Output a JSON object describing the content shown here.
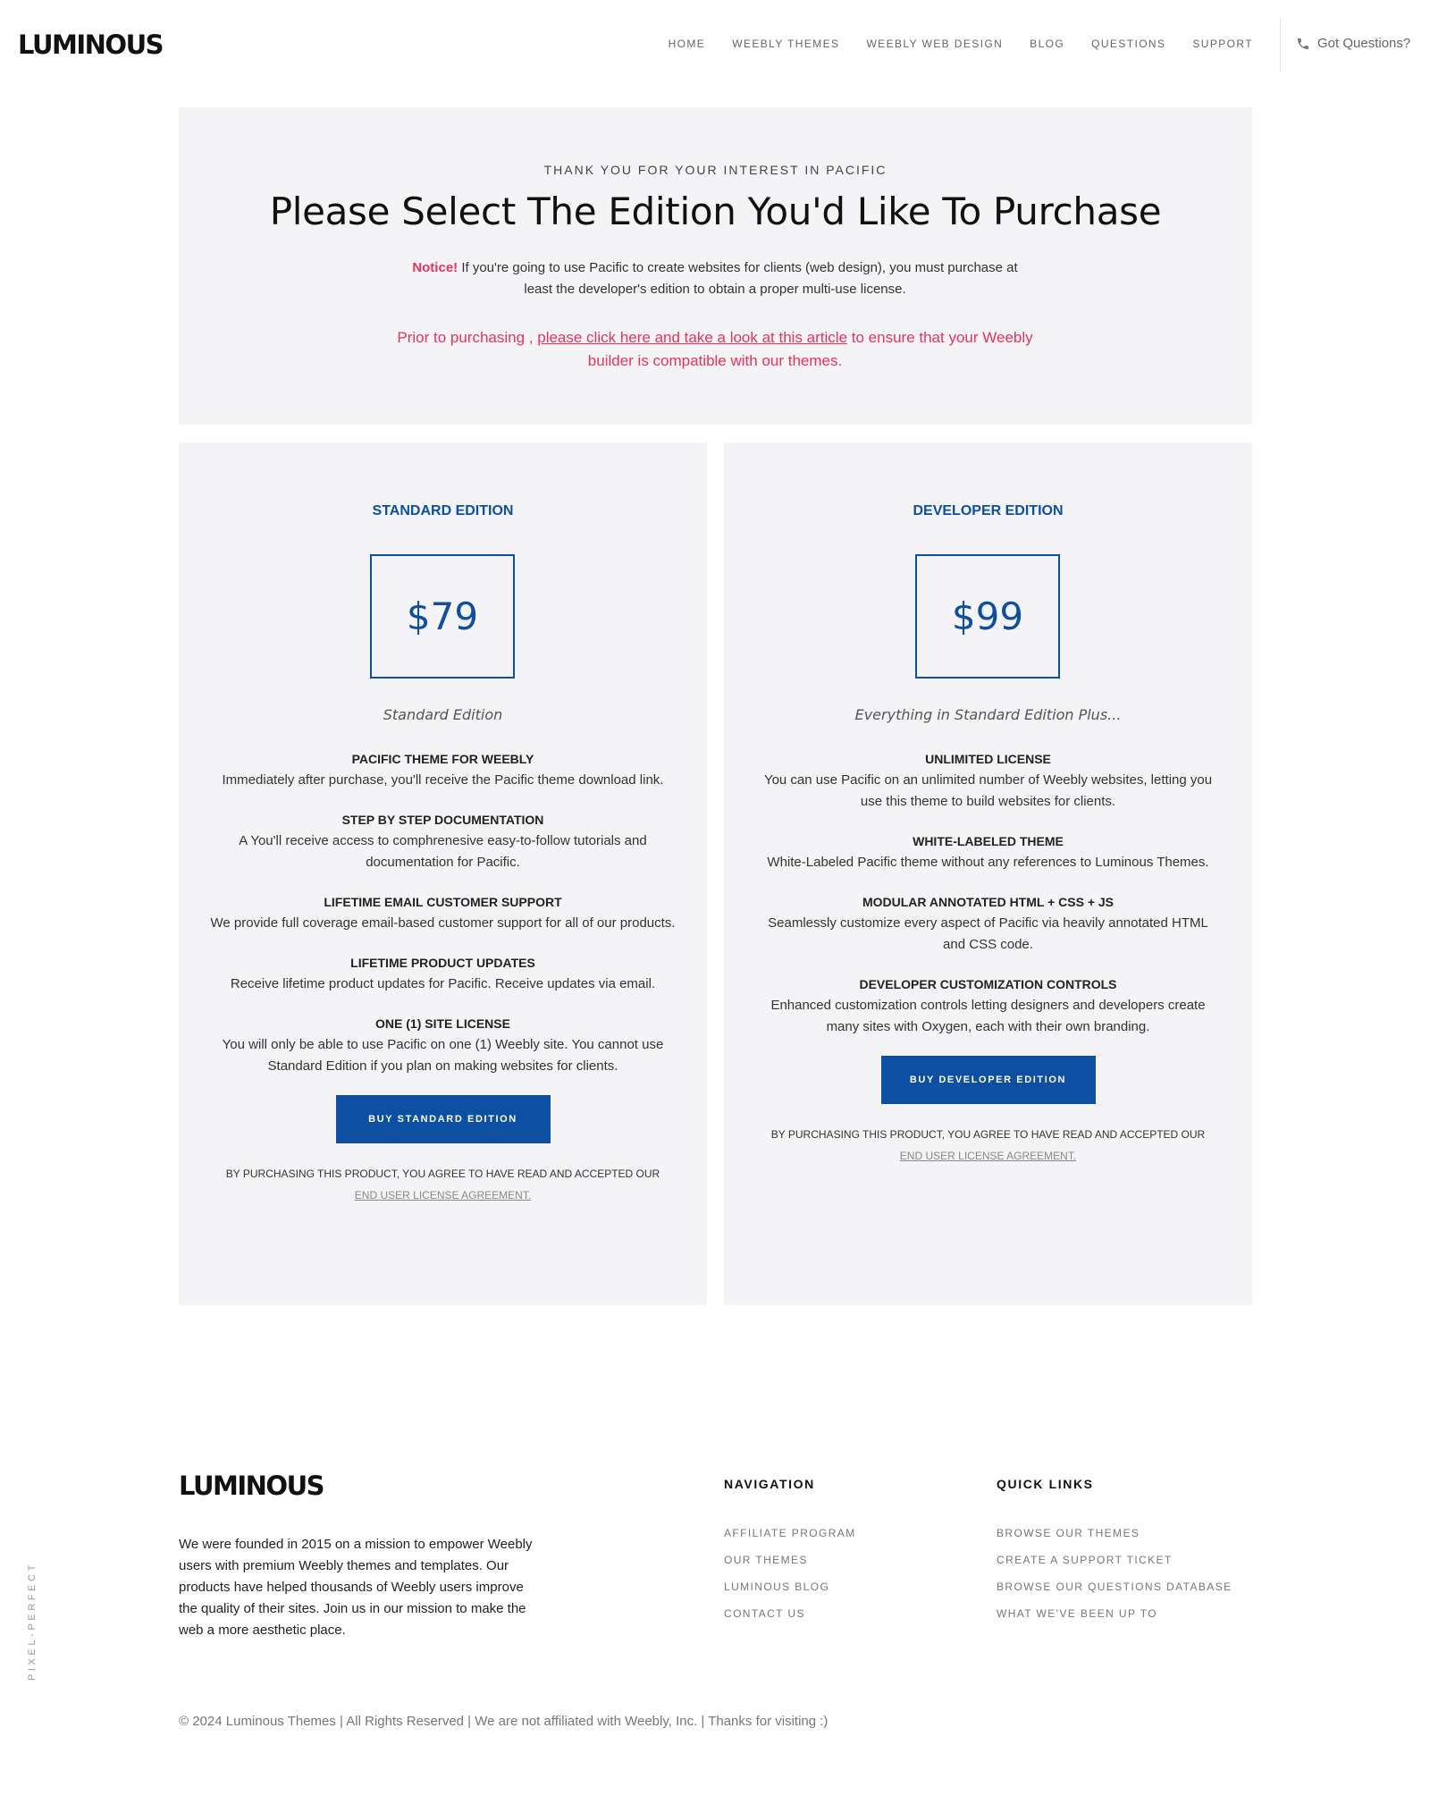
{
  "header": {
    "logo": "LUMINOUS",
    "nav": [
      "HOME",
      "WEEBLY THEMES",
      "WEEBLY WEB DESIGN",
      "BLOG",
      "QUESTIONS",
      "SUPPORT"
    ],
    "questions_label": "Got Questions?",
    "phone_icon": "phone-icon"
  },
  "hero": {
    "eyebrow": "THANK YOU FOR YOUR INTEREST IN PACIFIC",
    "title": "Please Select The Edition You'd Like To Purchase",
    "notice_label": "Notice!",
    "notice_text": " If you're going to use Pacific to create websites for clients (web design), you must purchase at least the developer's edition to obtain a proper multi-use license.",
    "prior_prefix": "Prior to purchasing , ",
    "prior_link": "please click here and take a look at this article",
    "prior_suffix": " to ensure that your Weebly builder is compatible with our themes."
  },
  "editions": [
    {
      "title": "STANDARD EDITION",
      "price": "$79",
      "subtitle": "Standard Edition",
      "features": [
        {
          "title": "PACIFIC THEME FOR WEEBLY",
          "desc": "Immediately after purchase, you'll receive the Pacific theme download link."
        },
        {
          "title": "STEP BY STEP DOCUMENTATION",
          "desc": "A You'll receive access to comphrenesive easy-to-follow tutorials and documentation for Pacific."
        },
        {
          "title": "LIFETIME EMAIL CUSTOMER SUPPORT",
          "desc": "We provide full coverage email-based customer support for all of our products."
        },
        {
          "title": "LIFETIME PRODUCT UPDATES",
          "desc": "Receive lifetime product updates for Pacific. Receive updates via email."
        },
        {
          "title": "ONE (1) SITE LICENSE",
          "desc": "You will only be able to use Pacific on one (1) Weebly site. You cannot use Standard Edition if you plan on making websites for clients."
        }
      ],
      "button": "BUY STANDARD EDITION",
      "agree_text": "By purchasing this product, you agree to have read and accepted our ",
      "agree_link": "End User License Agreement."
    },
    {
      "title": "DEVELOPER EDITION",
      "price": "$99",
      "subtitle": "Everything in Standard Edition Plus...",
      "features": [
        {
          "title": "UNLIMITED LICENSE",
          "desc": "You can use Pacific on an unlimited number of Weebly websites, letting you use this theme to build websites for clients."
        },
        {
          "title": "WHITE-LABELED THEME",
          "desc": "White-Labeled Pacific theme without any references to Luminous Themes."
        },
        {
          "title": "MODULAR ANNOTATED HTML + CSS + JS",
          "desc": "Seamlessly customize every aspect of Pacific via heavily annotated HTML and CSS code."
        },
        {
          "title": "DEVELOPER CUSTOMIZATION CONTROLS",
          "desc": "Enhanced customization controls letting designers and developers create many sites with Oxygen, each with their own branding."
        }
      ],
      "button": "BUY DEVELOPER EDITION",
      "agree_text": "By purchasing this product, you agree to have read and accepted our ",
      "agree_link": "End User License Agreement."
    }
  ],
  "footer": {
    "logo": "LUMINOUS",
    "about": "We were founded in 2015 on a mission to empower Weebly users with premium Weebly themes and templates. Our products have helped thousands of Weebly users improve the quality of their sites. Join us in our mission to make the web a more aesthetic place.",
    "navigation_title": "NAVIGATION",
    "navigation_links": [
      "AFFILIATE PROGRAM",
      "OUR THEMES",
      "LUMINOUS BLOG",
      "CONTACT US"
    ],
    "quick_title": "QUICK LINKS",
    "quick_links": [
      "BROWSE OUR THEMES",
      "CREATE A SUPPORT TICKET",
      "BROWSE OUR QUESTIONS DATABASE",
      "WHAT WE'VE BEEN UP TO"
    ],
    "vertical_text": "PIXEL-PERFECT",
    "copyright": "© 2024 Luminous Themes | All Rights Reserved | We are not affiliated with Weebly, Inc. | Thanks for visiting :)"
  },
  "colors": {
    "accent_blue": "#0d4fa3",
    "notice_red": "#e8335d",
    "panel_bg": "#f4f4f6"
  }
}
